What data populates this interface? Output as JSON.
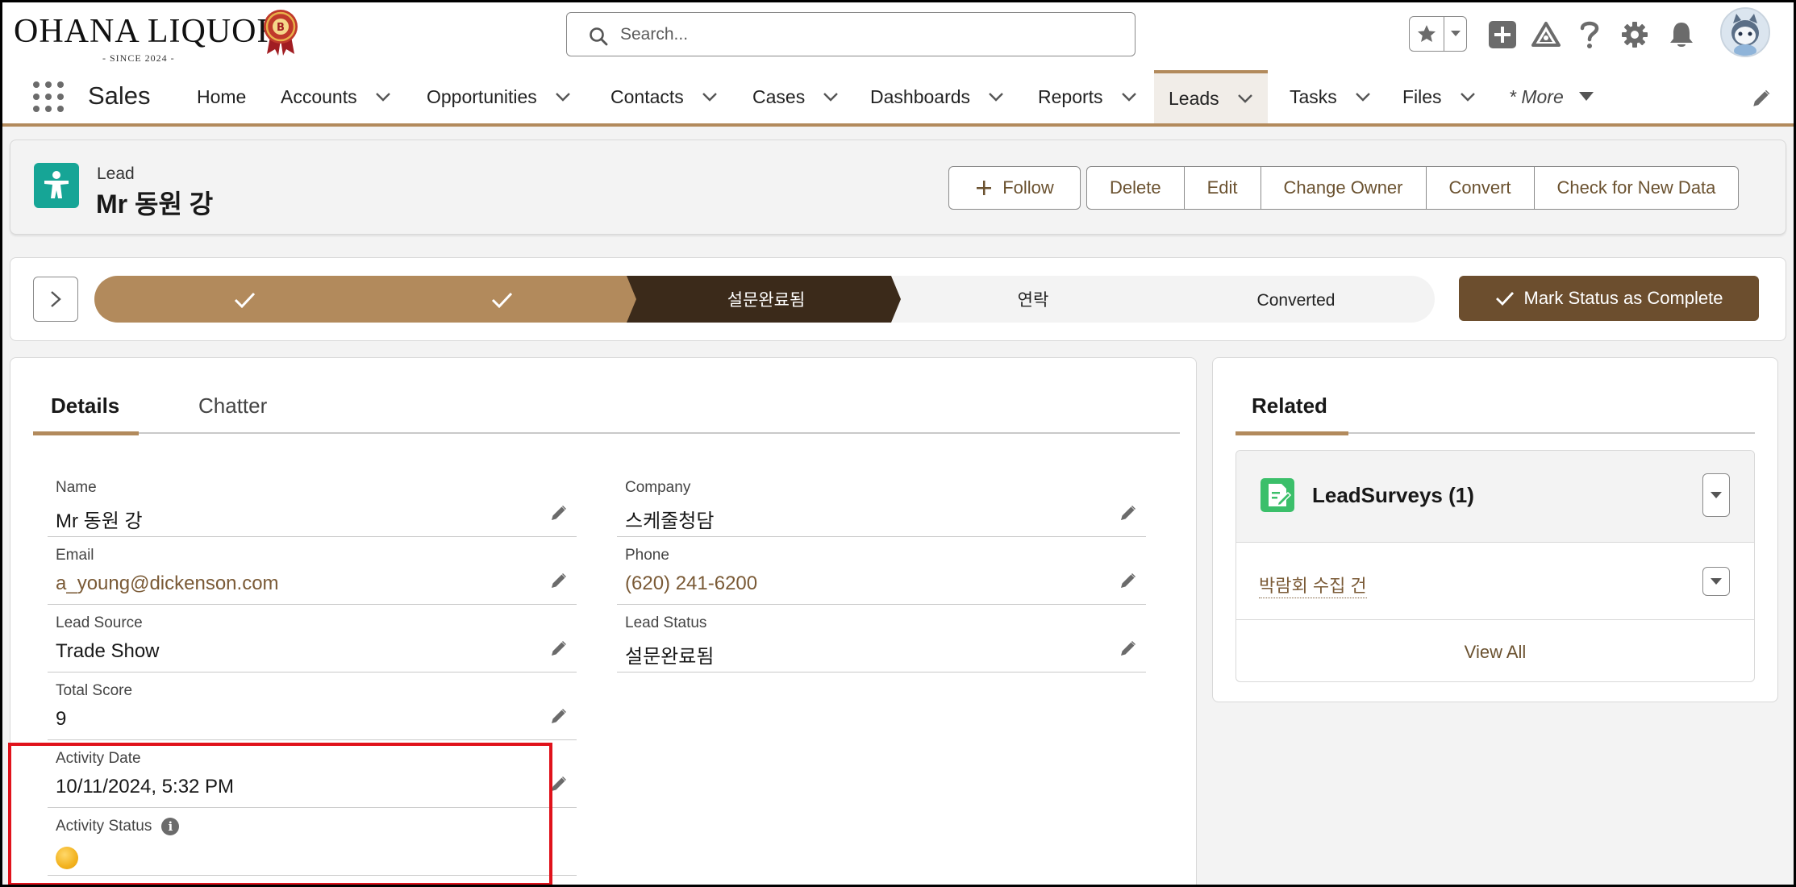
{
  "brand": {
    "name": "OHANA LIQUOR",
    "since": "- SINCE 2024 -",
    "badge_letter": "B"
  },
  "search": {
    "placeholder": "Search..."
  },
  "nav": {
    "app_name": "Sales",
    "items": [
      {
        "label": "Home"
      },
      {
        "label": "Accounts"
      },
      {
        "label": "Opportunities"
      },
      {
        "label": "Contacts"
      },
      {
        "label": "Cases"
      },
      {
        "label": "Dashboards"
      },
      {
        "label": "Reports"
      },
      {
        "label": "Leads"
      },
      {
        "label": "Tasks"
      },
      {
        "label": "Files"
      }
    ],
    "more_label": "* More",
    "active": "Leads"
  },
  "record": {
    "object_type": "Lead",
    "title": "Mr 동원 강",
    "follow_label": "Follow",
    "actions": [
      "Delete",
      "Edit",
      "Change Owner",
      "Convert",
      "Check for New Data"
    ]
  },
  "path": {
    "steps": [
      {
        "label": "",
        "state": "complete"
      },
      {
        "label": "",
        "state": "complete"
      },
      {
        "label": "설문완료됨",
        "state": "current"
      },
      {
        "label": "연락",
        "state": "incomplete"
      },
      {
        "label": "Converted",
        "state": "incomplete"
      }
    ],
    "mark_complete_label": "Mark Status as Complete"
  },
  "tabs": {
    "details": "Details",
    "chatter": "Chatter"
  },
  "fields": {
    "name": {
      "label": "Name",
      "value": "Mr 동원 강"
    },
    "company": {
      "label": "Company",
      "value": "스케줄청담"
    },
    "email": {
      "label": "Email",
      "value": "a_young@dickenson.com"
    },
    "phone": {
      "label": "Phone",
      "value": "(620) 241-6200"
    },
    "lead_source": {
      "label": "Lead Source",
      "value": "Trade Show"
    },
    "lead_status": {
      "label": "Lead Status",
      "value": "설문완료됨"
    },
    "total_score": {
      "label": "Total Score",
      "value": "9"
    },
    "activity_date": {
      "label": "Activity Date",
      "value": "10/11/2024, 5:32 PM"
    },
    "activity_status": {
      "label": "Activity Status",
      "indicator_color": "#f2b21e"
    }
  },
  "related": {
    "tab_label": "Related",
    "list_title": "LeadSurveys (1)",
    "items": [
      {
        "label": "박람회 수집 건"
      }
    ],
    "view_all": "View All"
  },
  "colors": {
    "accent": "#b28a5c",
    "accent_dark": "#6c4e2e",
    "path_current": "#3b2a1a",
    "lead_icon": "#16a596",
    "highlight": "#e0121b"
  }
}
